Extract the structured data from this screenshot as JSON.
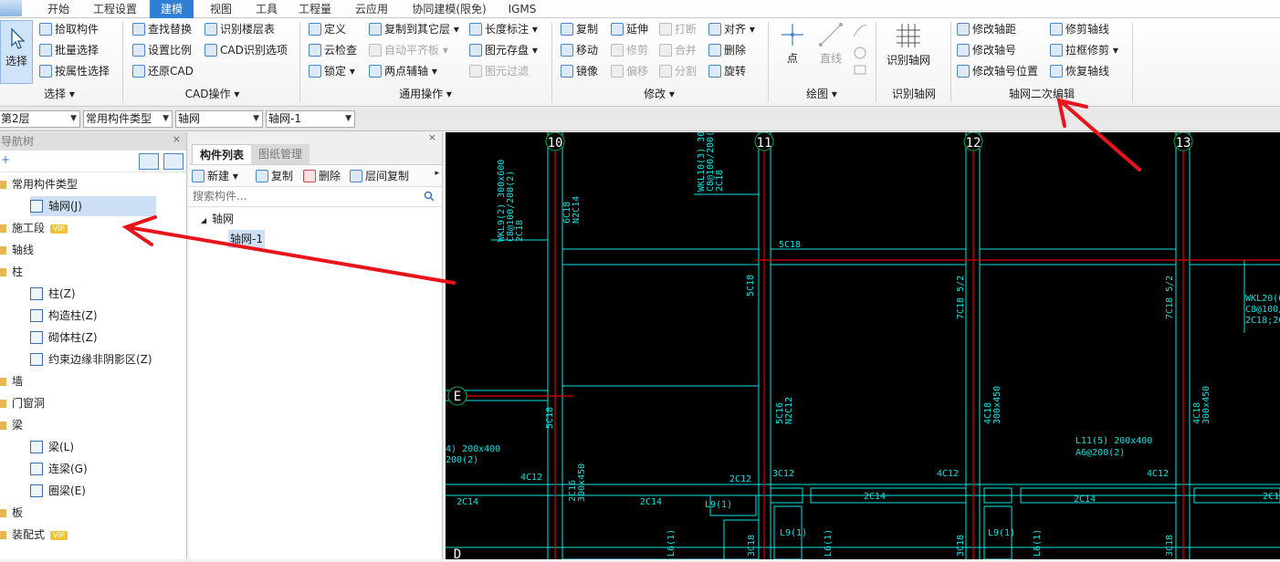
{
  "menubar": {
    "tabs": [
      "开始",
      "工程设置",
      "建模",
      "视图",
      "工具",
      "工程量",
      "云应用",
      "协同建模(限免)",
      "IGMS"
    ],
    "active_index": 2
  },
  "ribbon": {
    "select": {
      "big_button": "选择",
      "items": [
        "拾取构件",
        "批量选择",
        "按属性选择"
      ],
      "label": "选择"
    },
    "cad": {
      "col1": [
        "查找替换",
        "设置比例",
        "还原CAD"
      ],
      "col2": [
        "识别楼层表",
        "CAD识别选项"
      ],
      "label": "CAD操作"
    },
    "general": {
      "col1": [
        "定义",
        "云检查",
        "锁定"
      ],
      "col2": [
        "复制到其它层",
        "自动平齐板",
        "两点辅轴"
      ],
      "col3": [
        "长度标注",
        "图元存盘",
        "图元过滤"
      ],
      "label": "通用操作"
    },
    "modify": {
      "col1": [
        "复制",
        "移动",
        "镜像"
      ],
      "col2": [
        "延伸",
        "修剪",
        "偏移"
      ],
      "col3": [
        "打断",
        "合并",
        "分割"
      ],
      "col4": [
        "对齐",
        "删除",
        "旋转"
      ],
      "label": "修改"
    },
    "draw": {
      "items": [
        "点",
        "直线"
      ],
      "label": "绘图"
    },
    "recognize": {
      "big_button": "识别轴网",
      "label": "识别轴网"
    },
    "axis_edit": {
      "col1": [
        "修改轴距",
        "修改轴号",
        "修改轴号位置"
      ],
      "col2": [
        "修剪轴线",
        "拉框修剪",
        "恢复轴线"
      ],
      "label": "轴网二次编辑"
    }
  },
  "strip": {
    "floor": "第2层",
    "type": "常用构件类型",
    "category": "轴网",
    "instance": "轴网-1"
  },
  "nav": {
    "title": "导航树",
    "vip_label": "VIP",
    "items": [
      {
        "label": "常用构件类型",
        "kind": "folder",
        "indent": 0
      },
      {
        "label": "轴网(J)",
        "kind": "item",
        "indent": 1,
        "selected": true
      },
      {
        "label": "施工段",
        "kind": "folder",
        "indent": 0,
        "vip": true
      },
      {
        "label": "轴线",
        "kind": "folder",
        "indent": 0
      },
      {
        "label": "柱",
        "kind": "folder",
        "indent": 0
      },
      {
        "label": "柱(Z)",
        "kind": "item",
        "indent": 1
      },
      {
        "label": "构造柱(Z)",
        "kind": "item",
        "indent": 1
      },
      {
        "label": "砌体柱(Z)",
        "kind": "item",
        "indent": 1
      },
      {
        "label": "约束边缘非阴影区(Z)",
        "kind": "item",
        "indent": 1
      },
      {
        "label": "墙",
        "kind": "folder",
        "indent": 0
      },
      {
        "label": "门窗洞",
        "kind": "folder",
        "indent": 0
      },
      {
        "label": "梁",
        "kind": "folder",
        "indent": 0
      },
      {
        "label": "梁(L)",
        "kind": "item",
        "indent": 1
      },
      {
        "label": "连梁(G)",
        "kind": "item",
        "indent": 1
      },
      {
        "label": "圈梁(E)",
        "kind": "item",
        "indent": 1
      },
      {
        "label": "板",
        "kind": "folder",
        "indent": 0
      },
      {
        "label": "装配式",
        "kind": "folder",
        "indent": 0,
        "vip": true
      }
    ]
  },
  "comp": {
    "tabs": [
      "构件列表",
      "图纸管理"
    ],
    "toolbar": [
      "新建",
      "复制",
      "删除",
      "层间复制"
    ],
    "search_placeholder": "搜索构件...",
    "tree_root": "轴网",
    "tree_child": "轴网-1"
  },
  "canvas": {
    "axis_numbers": [
      "10",
      "11",
      "12",
      "13"
    ],
    "axis_letters": [
      "E",
      "D"
    ],
    "texts": [
      "WKL9(2) 300x600",
      "C8@100/200(2)",
      "2C18",
      "6C18",
      "N2C14",
      "WKL10(3) 300x",
      "C8@100/200(2)",
      "2C18",
      "5C18",
      "5C18",
      "7C18 5/2",
      "7C18 5/2",
      "WKL20(6",
      "C8@100/2",
      "2C18;2C1",
      "5C18",
      "5C16",
      "N2C12",
      "4C18",
      "300x450",
      "4C18",
      "300x450",
      "L11(5) 200x400",
      "A6@200(2)",
      "4) 200x400",
      "200(2)",
      "2C16",
      "300x450",
      "4C12",
      "2C12",
      "4C12",
      "4C12",
      "3C12",
      "2C14",
      "2C14",
      "2C14",
      "2C14",
      "2C14",
      "L9(1)",
      "L9(1)",
      "L9(1)",
      "L6(1)",
      "L6(1)",
      "L6(1)",
      "3C18",
      "3C18",
      "3C18"
    ],
    "colors": {
      "bg": "#000000",
      "cyan": "#00e5e5",
      "red": "#e00000",
      "green": "#00b050"
    }
  }
}
